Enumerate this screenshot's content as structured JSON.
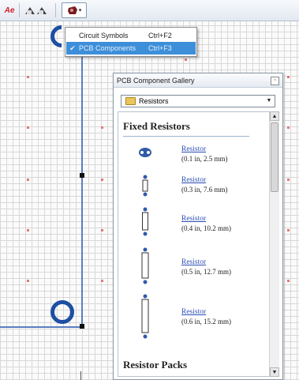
{
  "toolbar": {
    "ae_label": "Ae",
    "symbols_icon": "circuit-symbols-icon",
    "pcb_icon": "pcb-components-icon",
    "dropdown_caret": "▾"
  },
  "menu": {
    "items": [
      {
        "label": "Circuit Symbols",
        "shortcut": "Ctrl+F2",
        "checked": false,
        "check_mark": ""
      },
      {
        "label": "PCB Components",
        "shortcut": "Ctrl+F3",
        "checked": true,
        "check_mark": "✔"
      }
    ],
    "highlight_color": "#3d8fd9"
  },
  "gallery": {
    "title": "PCB Component Gallery",
    "close_label": "▫",
    "category": "Resistors",
    "select_arrow": "▼",
    "sections": [
      {
        "title": "Fixed Resistors"
      },
      {
        "title": "Resistor Packs"
      }
    ],
    "items": [
      {
        "name": "Resistor",
        "size": "(0.1 in, 2.5 mm)"
      },
      {
        "name": "Resistor",
        "size": "(0.3 in, 7.6 mm)"
      },
      {
        "name": "Resistor",
        "size": "(0.4 in, 10.2 mm)"
      },
      {
        "name": "Resistor",
        "size": "(0.5 in, 12.7 mm)"
      },
      {
        "name": "Resistor",
        "size": "(0.6 in, 15.2 mm)"
      }
    ],
    "scroll_up": "▲",
    "scroll_down": "▼"
  },
  "colors": {
    "trace_blue": "#1d4fa3",
    "sheet_border": "#5a7fc0",
    "link_blue": "#2a4db3"
  }
}
